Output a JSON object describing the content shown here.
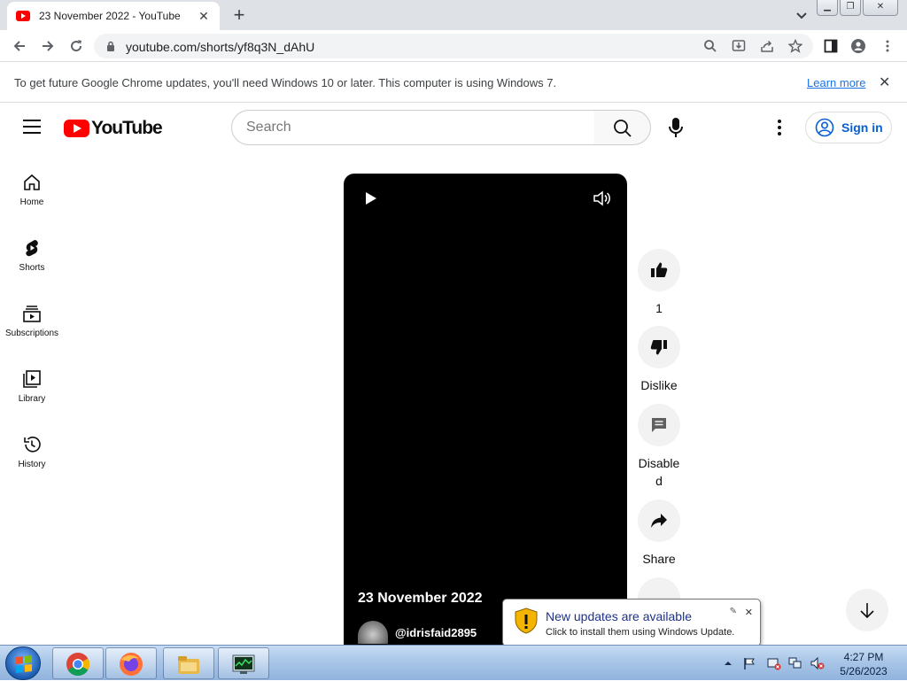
{
  "browser": {
    "tab_title": "23 November 2022 - YouTube",
    "new_tab_symbol": "+",
    "close_tab_symbol": "✕",
    "url": "youtube.com/shorts/yf8q3N_dAhU",
    "window_buttons": {
      "minimize": "▁",
      "maximize": "❐",
      "close": "✕"
    }
  },
  "infobar": {
    "message": "To get future Google Chrome updates, you'll need Windows 10 or later. This computer is using Windows 7.",
    "link_label": "Learn more",
    "close_symbol": "✕"
  },
  "youtube": {
    "logo_text": "YouTube",
    "search_placeholder": "Search",
    "sign_in_label": "Sign in",
    "nav": [
      {
        "label": "Home",
        "icon": "home-icon"
      },
      {
        "label": "Shorts",
        "icon": "shorts-icon"
      },
      {
        "label": "Subscriptions",
        "icon": "subscriptions-icon"
      },
      {
        "label": "Library",
        "icon": "library-icon"
      },
      {
        "label": "History",
        "icon": "history-icon"
      }
    ],
    "video": {
      "title": "23 November 2022",
      "channel": "@idrisfaid2895"
    },
    "actions": {
      "like_count": "1",
      "dislike_label": "Dislike",
      "comments_label": "Disable\nd",
      "share_label": "Share"
    }
  },
  "notification": {
    "title": "New updates are available",
    "subtitle": "Click to install them using Windows Update.",
    "close_symbol": "✕",
    "pin_symbol": "✎"
  },
  "taskbar": {
    "time": "4:27 PM",
    "date": "5/26/2023",
    "apps": [
      "chrome-icon",
      "firefox-icon",
      "explorer-icon",
      "task-manager-icon"
    ]
  },
  "colors": {
    "youtube_red": "#ff0000",
    "link_blue": "#1a73e8",
    "signin_blue": "#065fd4",
    "video_bg": "#000000"
  }
}
